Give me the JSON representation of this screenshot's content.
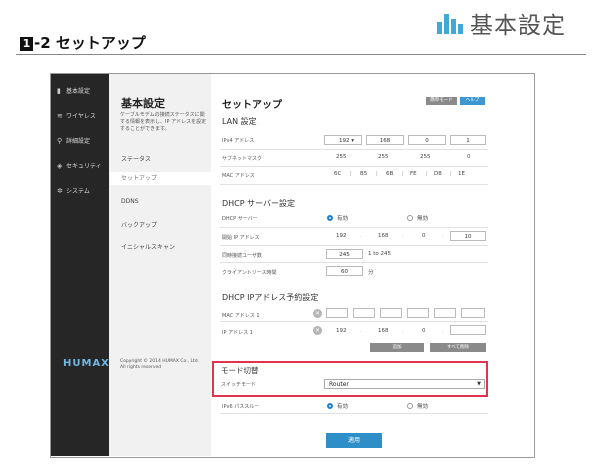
{
  "doc": {
    "header_title": "基本設定",
    "section_number": "1",
    "section_title": "-2 セットアップ"
  },
  "nav": {
    "items": [
      {
        "icon": "bar-chart-icon",
        "glyph": "▮",
        "label": "基本設定"
      },
      {
        "icon": "wifi-icon",
        "glyph": "≋",
        "label": "ワイヤレス"
      },
      {
        "icon": "person-icon",
        "glyph": "⚲",
        "label": "詳細設定"
      },
      {
        "icon": "shield-icon",
        "glyph": "◈",
        "label": "セキュリティ"
      },
      {
        "icon": "gear-icon",
        "glyph": "✲",
        "label": "システム"
      }
    ],
    "logo": "HUMAX"
  },
  "panel": {
    "title": "基本設定",
    "description": "ケーブルモデムの接続ステータスに関する情報を表示し、IP アドレスを設定することができます。",
    "items": [
      "ステータス",
      "セットアップ",
      "DDNS",
      "バックアップ",
      "イニシャルスキャン"
    ],
    "copyright_line1": "Copyright © 2014 HUMAX Co., Ltd.",
    "copyright_line2": "All rights reserved"
  },
  "main": {
    "title": "セットアップ",
    "mode_button": "簡単モード",
    "help_button": "ヘルプ",
    "lan": {
      "heading": "LAN 設定",
      "ipv4_label": "IPv4 アドレス",
      "ipv4": [
        "192",
        "168",
        "0",
        "1"
      ],
      "subnet_label": "サブネットマスク",
      "subnet": [
        "255",
        "255",
        "255",
        "0"
      ],
      "mac_label": "MAC アドレス",
      "mac": [
        "6C",
        "B5",
        "6B",
        "FE",
        "D8",
        "1E"
      ]
    },
    "dhcp": {
      "heading": "DHCP サーバー設定",
      "server_label": "DHCP サーバー",
      "enabled": "有効",
      "disabled": "無効",
      "start_label": "開始 IP アドレス",
      "start_ip": [
        "192",
        "168",
        "0",
        "10"
      ],
      "users_label": "同時接続ユーザ数",
      "users": "245",
      "users_range": "1 to 245",
      "lease_label": "クライアントリース時間",
      "lease": "60",
      "lease_unit": "分"
    },
    "reserve": {
      "heading": "DHCP IPアドレス予約設定",
      "mac_label": "MAC アドレス 1",
      "ip_label": "IP アドレス 1",
      "ip": [
        "192",
        "168",
        "0",
        ""
      ],
      "add_button": "追加",
      "delete_all_button": "すべて削除"
    },
    "mode": {
      "heading": "モード切替",
      "switch_label": "スイッチモード",
      "switch_value": "Router"
    },
    "ipv6": {
      "label": "IPv6 パススルー",
      "enabled": "有効",
      "disabled": "無効"
    },
    "apply_button": "適用"
  }
}
